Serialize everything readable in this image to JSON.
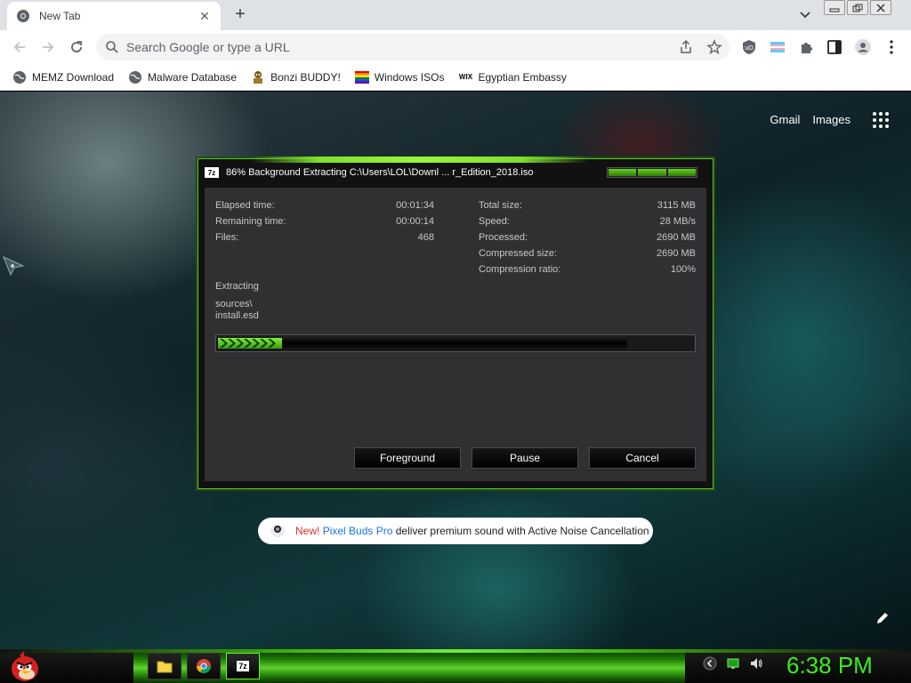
{
  "browser": {
    "tab": {
      "title": "New Tab",
      "close_glyph": "✕"
    },
    "new_tab_glyph": "+",
    "omnibox": {
      "placeholder": "Search Google or type a URL"
    },
    "bookmarks": [
      {
        "label": "MEMZ Download",
        "icon": "globe-icon"
      },
      {
        "label": "Malware Database",
        "icon": "globe-icon"
      },
      {
        "label": "Bonzi BUDDY!",
        "icon": "bonzi-icon"
      },
      {
        "label": "Windows ISOs",
        "icon": "rainbow-flag-icon"
      },
      {
        "label": "Egyptian Embassy",
        "icon": "wix-icon"
      }
    ],
    "wix_text": "WIX"
  },
  "google": {
    "links": [
      "Gmail",
      "Images"
    ],
    "promo": {
      "new": "New!",
      "product": "Pixel Buds Pro",
      "rest": "deliver premium sound with Active Noise Cancellation"
    }
  },
  "dialog": {
    "logo": "7z",
    "title": "86% Background Extracting C:\\Users\\LOL\\Downl ... r_Edition_2018.iso",
    "left_stats": [
      {
        "label": "Elapsed time:",
        "value": "00:01:34"
      },
      {
        "label": "Remaining time:",
        "value": "00:00:14"
      },
      {
        "label": "Files:",
        "value": "468"
      }
    ],
    "right_stats": [
      {
        "label": "Total size:",
        "value": "3115 MB"
      },
      {
        "label": "Speed:",
        "value": "28 MB/s"
      },
      {
        "label": "Processed:",
        "value": "2690 MB"
      },
      {
        "label": "Compressed size:",
        "value": "2690 MB"
      },
      {
        "label": "Compression ratio:",
        "value": "100%"
      }
    ],
    "operation": "Extracting",
    "current_path": "sources\\",
    "current_file": "install.esd",
    "progress_fraction": 0.86,
    "buttons": {
      "foreground": "Foreground",
      "pause": "Pause",
      "cancel": "Cancel"
    }
  },
  "taskbar": {
    "items": [
      "file-explorer-icon",
      "chrome-icon",
      "7zip-icon"
    ],
    "active_label": "7z",
    "clock": "6:38 PM"
  },
  "colors": {
    "accent_green": "#3bf01a",
    "dialog_body": "#303032",
    "promo_new": "#d93025",
    "promo_link": "#1a73e8"
  }
}
